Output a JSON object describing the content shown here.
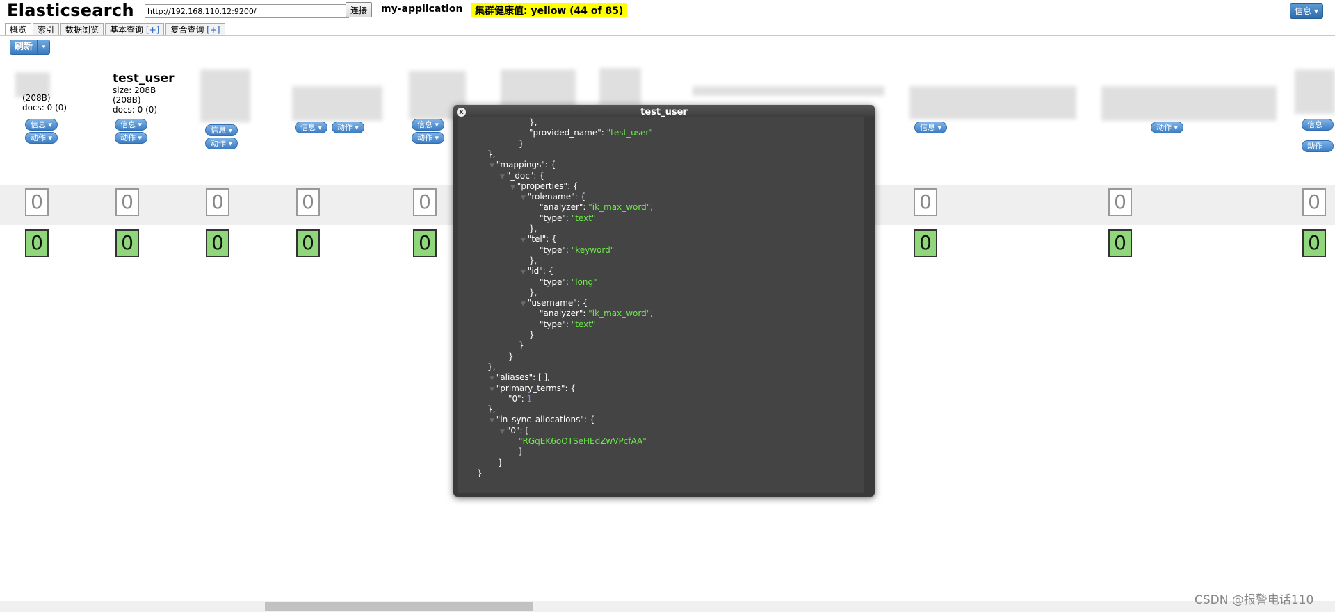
{
  "header": {
    "logo": "Elasticsearch",
    "url_value": "http://192.168.110.12:9200/",
    "connect_label": "连接",
    "cluster_name": "my-application",
    "health": "集群健康值: yellow (44 of 85)",
    "info_label": "信息 ▾"
  },
  "tabs": [
    {
      "label": "概览",
      "active": true
    },
    {
      "label": "索引"
    },
    {
      "label": "数据浏览"
    },
    {
      "label": "基本查询",
      "plus": "[+]"
    },
    {
      "label": "复合查询",
      "plus": "[+]"
    }
  ],
  "refresh": {
    "label": "刷新",
    "arrow": "▾"
  },
  "indices": {
    "first": {
      "size": "(208B)",
      "docs": "docs: 0 (0)",
      "info": "信息 ▾",
      "action": "动作 ▾"
    },
    "test_user": {
      "title": "test_user",
      "size": "size: 208B",
      "size2": "(208B)",
      "docs": "docs: 0 (0)",
      "info": "信息 ▾",
      "action": "动作 ▾"
    },
    "btn_info": "信息 ▾",
    "btn_action": "动作 ▾"
  },
  "shards": {
    "row1": [
      "0",
      "0",
      "0",
      "0",
      "0",
      "0",
      "0",
      "0",
      "0",
      "0",
      "0"
    ],
    "row2": [
      "0",
      "0",
      "0",
      "0",
      "0",
      "0",
      "0",
      "0",
      "0",
      "0",
      "0"
    ]
  },
  "modal": {
    "title": "test_user",
    "close": "x",
    "lines": [
      {
        "indent": 5,
        "t": [
          [
            "k",
            "},"
          ]
        ]
      },
      {
        "indent": 5,
        "t": [
          [
            "k",
            "\"provided_name\": "
          ],
          [
            "s",
            "\"test_user\""
          ]
        ]
      },
      {
        "indent": 4,
        "t": [
          [
            "k",
            "}"
          ]
        ]
      },
      {
        "indent": 1,
        "t": [
          [
            "k",
            "},"
          ]
        ]
      },
      {
        "indent": 2,
        "tw": true,
        "t": [
          [
            "k",
            "\"mappings\": {"
          ]
        ]
      },
      {
        "indent": 3,
        "tw": true,
        "t": [
          [
            "k",
            "\"_doc\": {"
          ]
        ]
      },
      {
        "indent": 4,
        "tw": true,
        "t": [
          [
            "k",
            "\"properties\": {"
          ]
        ]
      },
      {
        "indent": 5,
        "tw": true,
        "t": [
          [
            "k",
            "\"rolename\": {"
          ]
        ]
      },
      {
        "indent": 6,
        "t": [
          [
            "k",
            "\"analyzer\": "
          ],
          [
            "s",
            "\"ik_max_word\""
          ],
          [
            "k",
            ","
          ]
        ]
      },
      {
        "indent": 6,
        "t": [
          [
            "k",
            "\"type\": "
          ],
          [
            "s",
            "\"text\""
          ]
        ]
      },
      {
        "indent": 5,
        "t": [
          [
            "k",
            "},"
          ]
        ]
      },
      {
        "indent": 5,
        "tw": true,
        "t": [
          [
            "k",
            "\"tel\": {"
          ]
        ]
      },
      {
        "indent": 6,
        "t": [
          [
            "k",
            "\"type\": "
          ],
          [
            "s",
            "\"keyword\""
          ]
        ]
      },
      {
        "indent": 5,
        "t": [
          [
            "k",
            "},"
          ]
        ]
      },
      {
        "indent": 5,
        "tw": true,
        "t": [
          [
            "k",
            "\"id\": {"
          ]
        ]
      },
      {
        "indent": 6,
        "t": [
          [
            "k",
            "\"type\": "
          ],
          [
            "s",
            "\"long\""
          ]
        ]
      },
      {
        "indent": 5,
        "t": [
          [
            "k",
            "},"
          ]
        ]
      },
      {
        "indent": 5,
        "tw": true,
        "t": [
          [
            "k",
            "\"username\": {"
          ]
        ]
      },
      {
        "indent": 6,
        "t": [
          [
            "k",
            "\"analyzer\": "
          ],
          [
            "s",
            "\"ik_max_word\""
          ],
          [
            "k",
            ","
          ]
        ]
      },
      {
        "indent": 6,
        "t": [
          [
            "k",
            "\"type\": "
          ],
          [
            "s",
            "\"text\""
          ]
        ]
      },
      {
        "indent": 5,
        "t": [
          [
            "k",
            "}"
          ]
        ]
      },
      {
        "indent": 4,
        "t": [
          [
            "k",
            "}"
          ]
        ]
      },
      {
        "indent": 3,
        "t": [
          [
            "k",
            "}"
          ]
        ]
      },
      {
        "indent": 1,
        "t": [
          [
            "k",
            "},"
          ]
        ]
      },
      {
        "indent": 2,
        "tw": true,
        "t": [
          [
            "k",
            "\"aliases\": [ ],"
          ]
        ]
      },
      {
        "indent": 2,
        "tw": true,
        "t": [
          [
            "k",
            "\"primary_terms\": {"
          ]
        ]
      },
      {
        "indent": 3,
        "t": [
          [
            "k",
            "\"0\": "
          ],
          [
            "n",
            "1"
          ]
        ]
      },
      {
        "indent": 1,
        "t": [
          [
            "k",
            "},"
          ]
        ]
      },
      {
        "indent": 2,
        "tw": true,
        "t": [
          [
            "k",
            "\"in_sync_allocations\": {"
          ]
        ]
      },
      {
        "indent": 3,
        "tw": true,
        "t": [
          [
            "k",
            "\"0\": ["
          ]
        ]
      },
      {
        "indent": 4,
        "t": [
          [
            "s",
            "\"RGqEK6oOTSeHEdZwVPcfAA\""
          ]
        ]
      },
      {
        "indent": 4,
        "t": [
          [
            "k",
            "]"
          ]
        ]
      },
      {
        "indent": 2,
        "t": [
          [
            "k",
            "}"
          ]
        ]
      },
      {
        "indent": 0,
        "t": [
          [
            "k",
            "}"
          ]
        ]
      }
    ]
  },
  "watermark": "CSDN @报警电话110",
  "colors": {
    "health_bg": "#ffff00",
    "json_string": "#6dec4a",
    "json_number": "#6b8dff",
    "shard_green": "#8fd77a"
  }
}
